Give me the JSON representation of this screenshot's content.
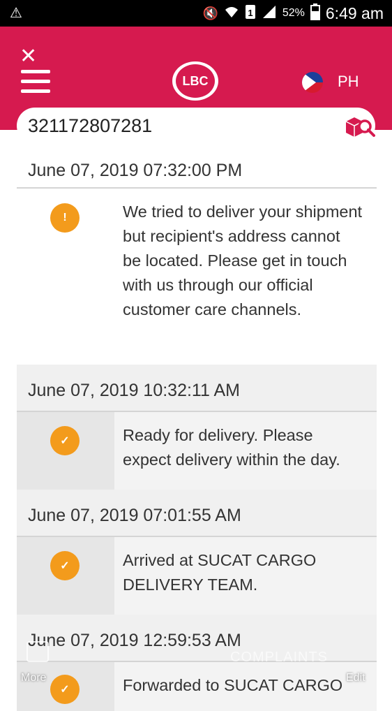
{
  "status_bar": {
    "battery_pct": "52%",
    "time": "6:49 am"
  },
  "header": {
    "close_glyph": "✕",
    "logo_text": "LBC",
    "country": "PH",
    "brand_color": "#d61a4f",
    "flag_icon": "philippines-flag-icon",
    "menu_icon": "hamburger-menu-icon"
  },
  "search": {
    "value": "321172807281",
    "icon": "package-search-icon"
  },
  "timeline": [
    {
      "date": "June 07, 2019 07:32:00 PM",
      "status": "warning",
      "icon_glyph": "!",
      "text": "We tried to deliver your shipment but recipient's address cannot be located. Please get in touch with us through our official customer care channels."
    },
    {
      "date": "June 07, 2019 10:32:11 AM",
      "status": "done",
      "icon_glyph": "✓",
      "text": "Ready for delivery. Please expect delivery within the day."
    },
    {
      "date": "June 07, 2019 07:01:55 AM",
      "status": "done",
      "icon_glyph": "✓",
      "text": "Arrived at SUCAT CARGO DELIVERY TEAM."
    },
    {
      "date": "June 07, 2019 12:59:53 AM",
      "status": "done",
      "icon_glyph": "✓",
      "text": "Forwarded to SUCAT CARGO"
    }
  ],
  "overlay": {
    "more_label": "More",
    "edit_label": "Edit",
    "brand_text": "COMPLAINTS"
  },
  "colors": {
    "accent_orange": "#f39b1c"
  }
}
